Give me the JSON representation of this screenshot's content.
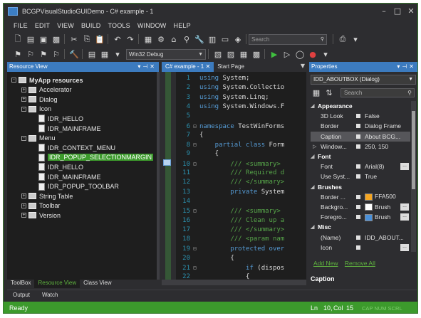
{
  "window": {
    "title": "BCGPVisualStudioGUIDemo - C# example - 1"
  },
  "menu": [
    "FILE",
    "EDIT",
    "VIEW",
    "BUILD",
    "TOOLS",
    "WINDOW",
    "HELP"
  ],
  "toolbar": {
    "search_placeholder": "Search",
    "config": "Win32 Debug"
  },
  "resource_view": {
    "title": "Resource View",
    "tree": [
      {
        "label": "MyApp resources",
        "level": 0,
        "kind": "folder",
        "exp": "-",
        "bold": true
      },
      {
        "label": "Accelerator",
        "level": 1,
        "kind": "folder",
        "exp": "+"
      },
      {
        "label": "Dialog",
        "level": 1,
        "kind": "folder",
        "exp": "+"
      },
      {
        "label": "Icon",
        "level": 1,
        "kind": "folder",
        "exp": "-"
      },
      {
        "label": "IDR_HELLO",
        "level": 2,
        "kind": "doc"
      },
      {
        "label": "IDR_MAINFRAME",
        "level": 2,
        "kind": "doc"
      },
      {
        "label": "Menu",
        "level": 1,
        "kind": "folder",
        "exp": "-"
      },
      {
        "label": "IDR_CONTEXT_MENU",
        "level": 2,
        "kind": "doc"
      },
      {
        "label": "IDR_POPUP_SELECTIONMARGIN",
        "level": 2,
        "kind": "doc",
        "selected": true
      },
      {
        "label": "IDR_HELLO",
        "level": 2,
        "kind": "doc"
      },
      {
        "label": "IDR_MAINFRAME",
        "level": 2,
        "kind": "doc"
      },
      {
        "label": "IDR_POPUP_TOOLBAR",
        "level": 2,
        "kind": "doc"
      },
      {
        "label": "String Table",
        "level": 1,
        "kind": "folder",
        "exp": "+"
      },
      {
        "label": "Toolbar",
        "level": 1,
        "kind": "folder",
        "exp": "+"
      },
      {
        "label": "Version",
        "level": 1,
        "kind": "folder",
        "exp": "+"
      }
    ],
    "tabs": [
      "ToolBox",
      "Resource View",
      "Class View"
    ],
    "active_tab": "Resource View"
  },
  "output_tabs": [
    "Output",
    "Watch"
  ],
  "editor": {
    "tabs": [
      "C# example - 1",
      "Start Page"
    ],
    "lines": [
      {
        "n": "1",
        "fold": "",
        "segs": [
          {
            "t": "using ",
            "c": "kw"
          },
          {
            "t": "System;",
            "c": "tx"
          }
        ]
      },
      {
        "n": "2",
        "fold": "",
        "segs": [
          {
            "t": "using ",
            "c": "kw"
          },
          {
            "t": "System.Collectio",
            "c": "tx"
          }
        ]
      },
      {
        "n": "3",
        "fold": "",
        "segs": [
          {
            "t": "using ",
            "c": "kw"
          },
          {
            "t": "System.Linq;",
            "c": "tx"
          }
        ]
      },
      {
        "n": "4",
        "fold": "",
        "segs": [
          {
            "t": "using ",
            "c": "kw"
          },
          {
            "t": "System.Windows.F",
            "c": "tx"
          }
        ]
      },
      {
        "n": "5",
        "fold": "",
        "segs": []
      },
      {
        "n": "6",
        "fold": "⊟",
        "segs": [
          {
            "t": "namespace ",
            "c": "kw"
          },
          {
            "t": "TestWinForms",
            "c": "tx"
          }
        ]
      },
      {
        "n": "7",
        "fold": "",
        "segs": [
          {
            "t": "{",
            "c": "tx"
          }
        ]
      },
      {
        "n": "8",
        "fold": "⊟",
        "segs": [
          {
            "t": "    partial class ",
            "c": "kw"
          },
          {
            "t": "Form",
            "c": "tx"
          }
        ]
      },
      {
        "n": "9",
        "fold": "",
        "segs": [
          {
            "t": "    {",
            "c": "tx"
          }
        ]
      },
      {
        "n": "10",
        "fold": "⊟",
        "segs": [
          {
            "t": "        /// <summary>",
            "c": "cm"
          }
        ]
      },
      {
        "n": "11",
        "fold": "",
        "segs": [
          {
            "t": "        /// Required d",
            "c": "cm"
          }
        ]
      },
      {
        "n": "12",
        "fold": "",
        "segs": [
          {
            "t": "        /// </summary>",
            "c": "cm"
          }
        ]
      },
      {
        "n": "13",
        "fold": "",
        "segs": [
          {
            "t": "        private ",
            "c": "kw"
          },
          {
            "t": "System",
            "c": "tx"
          }
        ]
      },
      {
        "n": "14",
        "fold": "",
        "segs": []
      },
      {
        "n": "15",
        "fold": "⊟",
        "segs": [
          {
            "t": "        /// <summary>",
            "c": "cm"
          }
        ]
      },
      {
        "n": "16",
        "fold": "",
        "segs": [
          {
            "t": "        /// Clean up a",
            "c": "cm"
          }
        ]
      },
      {
        "n": "17",
        "fold": "",
        "segs": [
          {
            "t": "        /// </summary>",
            "c": "cm"
          }
        ]
      },
      {
        "n": "18",
        "fold": "",
        "segs": [
          {
            "t": "        /// <param nam",
            "c": "cm"
          }
        ]
      },
      {
        "n": "19",
        "fold": "⊟",
        "segs": [
          {
            "t": "        protected over",
            "c": "kw"
          }
        ]
      },
      {
        "n": "20",
        "fold": "",
        "segs": [
          {
            "t": "        {",
            "c": "tx"
          }
        ]
      },
      {
        "n": "21",
        "fold": "⊟",
        "segs": [
          {
            "t": "            if ",
            "c": "kw"
          },
          {
            "t": "(dispos",
            "c": "tx"
          }
        ]
      },
      {
        "n": "22",
        "fold": "",
        "segs": [
          {
            "t": "            {",
            "c": "tx"
          }
        ]
      }
    ]
  },
  "properties": {
    "title": "Properties",
    "object": "IDD_ABOUTBOX (Dialog)",
    "search_placeholder": "Search",
    "rows": [
      {
        "type": "cat",
        "name": "Appearance"
      },
      {
        "type": "prop",
        "name": "3D Look",
        "value": "False",
        "box": true
      },
      {
        "type": "prop",
        "name": "Border",
        "value": "Dialog Frame",
        "box": true
      },
      {
        "type": "prop",
        "name": "Caption",
        "value": "About BCG...",
        "box": true,
        "selected": true
      },
      {
        "type": "prop",
        "name": "Window...",
        "value": "250, 150",
        "box": true,
        "expander": true
      },
      {
        "type": "cat",
        "name": "Font"
      },
      {
        "type": "prop",
        "name": "Font",
        "value": "Arial(8)",
        "box": true,
        "dots": true
      },
      {
        "type": "prop",
        "name": "Use Syst...",
        "value": "True",
        "box": true
      },
      {
        "type": "cat",
        "name": "Brushes"
      },
      {
        "type": "prop",
        "name": "Border ...",
        "value": "FFA500",
        "box": true,
        "swatch": "#f5a623"
      },
      {
        "type": "prop",
        "name": "Backgro...",
        "value": "Brush",
        "box": true,
        "swatch": "#ffffff",
        "dots": true
      },
      {
        "type": "prop",
        "name": "Foregro...",
        "value": "Brush",
        "box": true,
        "swatch": "#4a90d9",
        "dots": true
      },
      {
        "type": "cat",
        "name": "Misc"
      },
      {
        "type": "prop",
        "name": "(Name)",
        "value": "IDD_ABOUT...",
        "box": true
      },
      {
        "type": "prop",
        "name": "Icon",
        "value": "",
        "box": true,
        "dots": true
      }
    ],
    "links": [
      "Add New",
      "Remove All"
    ],
    "description": "Caption"
  },
  "status": {
    "text": "Ready",
    "ln": "Ln",
    "ln_val": "10,",
    "col": "Col",
    "col_val": "15",
    "mode": "CAP NUM SCRL"
  },
  "colors": {
    "accent_green": "#3c9a2c",
    "panel_blue": "#3c7bbf",
    "bg": "#2d2d30",
    "editor_bg": "#1e1e1e"
  }
}
